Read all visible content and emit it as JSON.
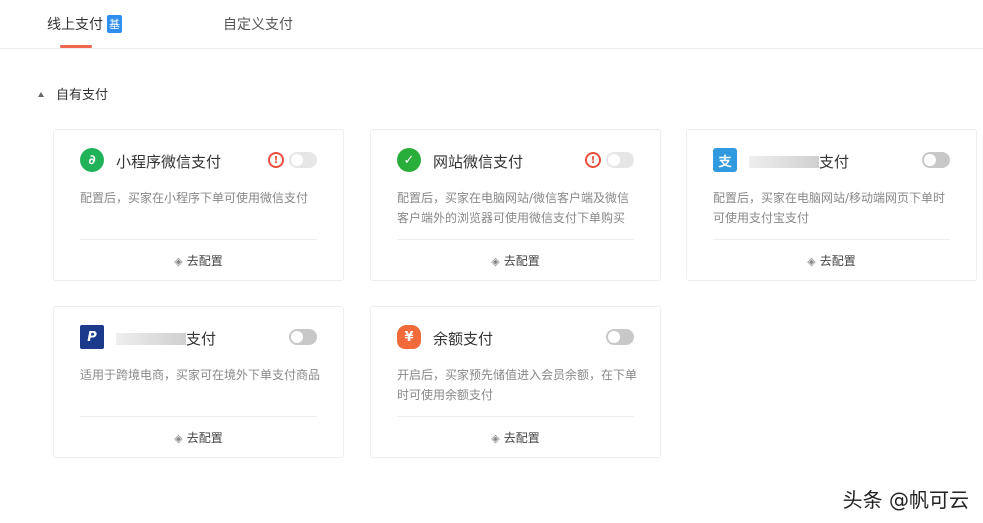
{
  "tabs": [
    {
      "label": "线上支付",
      "badge": "基"
    },
    {
      "label": "自定义支付"
    }
  ],
  "section": "自有支付",
  "cards": [
    {
      "name": "小程序微信支付",
      "desc": "配置后，买家在小程序下单可使用微信支付",
      "action": "去配置",
      "color": "#21b35a",
      "glyph": "∂"
    },
    {
      "name": "网站微信支付",
      "desc": "配置后，买家在电脑网站/微信客户端及微信客户端外的浏览器可使用微信支付下单购买",
      "action": "去配置",
      "color": "#2aae3b",
      "glyph": "✓"
    },
    {
      "name": "支付",
      "desc": "配置后，买家在电脑网站/移动端网页下单时可使用支付宝支付",
      "action": "去配置",
      "color": "#2f9ae0",
      "glyph": "支"
    },
    {
      "name": "支付",
      "desc": "适用于跨境电商，买家可在境外下单支付商品",
      "action": "去配置",
      "color": "#1b3a8c",
      "glyph": "P"
    },
    {
      "name": "余额支付",
      "desc": "开启后，买家预先储值进入会员余额，在下单时可使用余额支付",
      "action": "去配置",
      "color": "#f06a3a",
      "glyph": "¥"
    }
  ],
  "watermark": "头条 @帆可云"
}
